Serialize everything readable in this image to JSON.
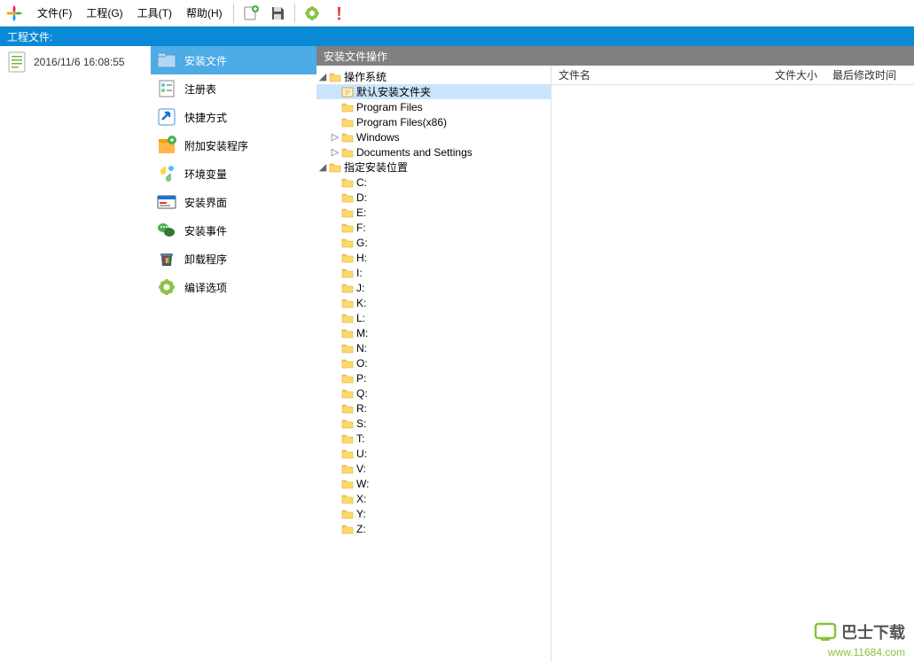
{
  "menubar": {
    "items": [
      {
        "label": "文件(F)"
      },
      {
        "label": "工程(G)"
      },
      {
        "label": "工具(T)"
      },
      {
        "label": "帮助(H)"
      }
    ]
  },
  "bluebar": {
    "label": "工程文件:"
  },
  "project": {
    "timestamp": "2016/11/6 16:08:55"
  },
  "nav": {
    "items": [
      {
        "label": "安装文件",
        "icon": "install-files-icon",
        "active": true
      },
      {
        "label": "注册表",
        "icon": "registry-icon"
      },
      {
        "label": "快捷方式",
        "icon": "shortcut-icon"
      },
      {
        "label": "附加安装程序",
        "icon": "addon-icon"
      },
      {
        "label": "环境变量",
        "icon": "env-icon"
      },
      {
        "label": "安装界面",
        "icon": "ui-icon"
      },
      {
        "label": "安装事件",
        "icon": "events-icon"
      },
      {
        "label": "卸载程序",
        "icon": "uninstall-icon"
      },
      {
        "label": "编译选项",
        "icon": "compile-icon"
      }
    ]
  },
  "graybar": {
    "label": "安装文件操作"
  },
  "tree": {
    "os_label": "操作系统",
    "os_children": [
      {
        "label": "默认安装文件夹",
        "selected": true,
        "special": true
      },
      {
        "label": "Program Files"
      },
      {
        "label": "Program Files(x86)"
      },
      {
        "label": "Windows",
        "expandable": true
      },
      {
        "label": "Documents and Settings",
        "expandable": true
      }
    ],
    "loc_label": "指定安装位置",
    "drives": [
      "C:",
      "D:",
      "E:",
      "F:",
      "G:",
      "H:",
      "I:",
      "J:",
      "K:",
      "L:",
      "M:",
      "N:",
      "O:",
      "P:",
      "Q:",
      "R:",
      "S:",
      "T:",
      "U:",
      "V:",
      "W:",
      "X:",
      "Y:",
      "Z:"
    ]
  },
  "list_header": {
    "name": "文件名",
    "size": "文件大小",
    "date": "最后修改时间"
  },
  "watermark": {
    "brand": "巴士下载",
    "url": "www.11684.com"
  }
}
